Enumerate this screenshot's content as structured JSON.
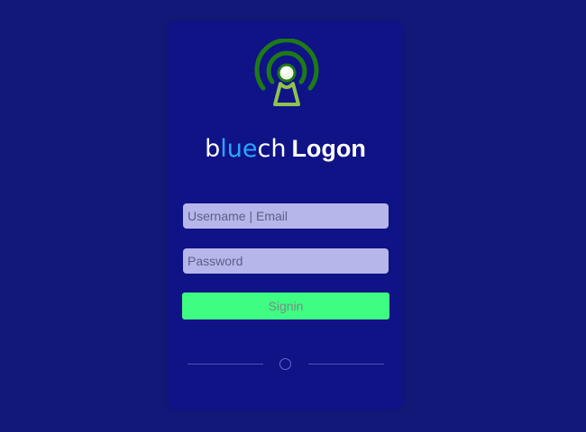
{
  "logon": {
    "brand": {
      "part1": "b",
      "part2": "lue",
      "part3": "ch"
    },
    "title_word": "Logon",
    "username": {
      "placeholder": "Username | Email"
    },
    "password": {
      "placeholder": "Password"
    },
    "signin_label": "Signin",
    "logo_icon": "broadcast-tower-icon",
    "loading_icon": "circle-spinner-icon"
  },
  "colors": {
    "page_bg": "#121878",
    "card_bg": "#0f1386",
    "brand_accent": "#2aa6ff",
    "input_bg": "#b6b6ea",
    "button_bg": "#3ffc83",
    "logo_green": "#1e7a16",
    "logo_light": "#8fc24f"
  }
}
